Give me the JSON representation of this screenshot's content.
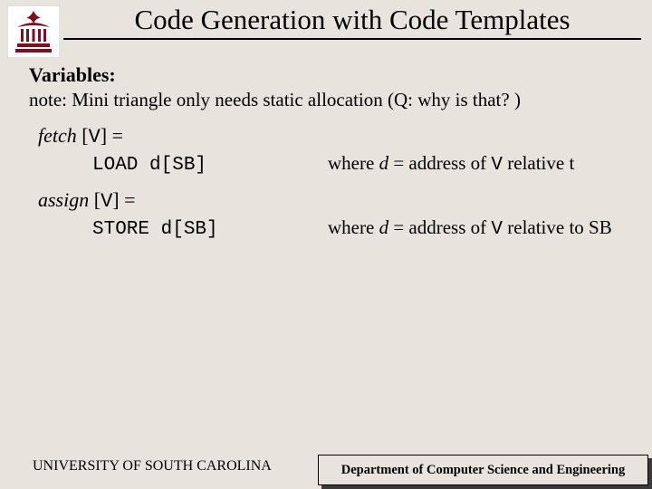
{
  "title": "Code Generation with Code Templates",
  "variables_heading": "Variables:",
  "note": "note: Mini triangle only needs static allocation (Q: why is that? )",
  "fetch": {
    "name": "fetch",
    "arg": "V",
    "code": "LOAD d[SB]",
    "where_prefix": "where ",
    "where_d": "d",
    "where_mid": " = address of ",
    "where_v": "V",
    "where_suffix": " relative t"
  },
  "assign": {
    "name": "assign",
    "arg": "V",
    "code": "STORE d[SB]",
    "where_prefix": "where ",
    "where_d": "d",
    "where_mid": " = address of ",
    "where_v": "V",
    "where_suffix": " relative to SB"
  },
  "footer": {
    "left": "UNIVERSITY OF SOUTH CAROLINA",
    "right": "Department of Computer Science and Engineering"
  }
}
